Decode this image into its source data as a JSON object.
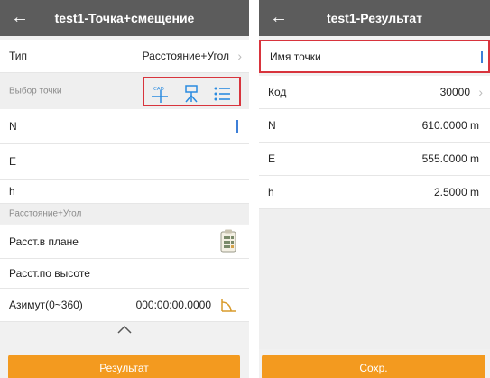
{
  "left": {
    "back_icon": "arrow-left-icon",
    "title": "test1-Точка+смещение",
    "type_label": "Тип",
    "type_value": "Расстояние+Угол",
    "point_section_label": "Выбор точки",
    "point_tools": [
      "cad-pick-icon",
      "survey-point-icon",
      "list-icon"
    ],
    "fields": [
      {
        "label": "N"
      },
      {
        "label": "E"
      },
      {
        "label": "h"
      }
    ],
    "offset_section_label": "Расстояние+Угол",
    "horizontal_distance_label": "Расст.в плане",
    "vertical_distance_label": "Расст.по высоте",
    "azimuth_label": "Азимут(0~360)",
    "azimuth_value": "000:00:00.0000",
    "result_button": "Результат"
  },
  "right": {
    "back_icon": "arrow-left-icon",
    "title": "test1-Результат",
    "point_name_label": "Имя точки",
    "code_label": "Код",
    "code_value": "30000",
    "n_label": "N",
    "n_value": "610.0000 m",
    "e_label": "E",
    "e_value": "555.0000 m",
    "h_label": "h",
    "h_value": "2.5000 m",
    "save_button": "Сохр."
  },
  "colors": {
    "header": "#5c5c5c",
    "accent": "#f39a1f",
    "icon_blue": "#2a8be0",
    "highlight_red": "#d8343d"
  }
}
